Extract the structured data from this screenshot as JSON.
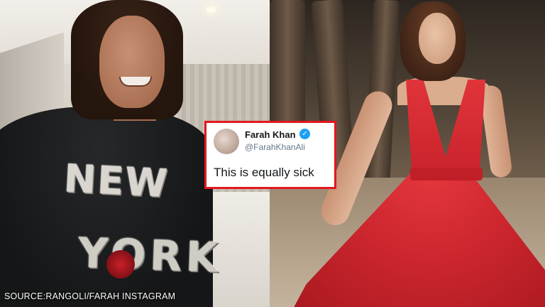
{
  "tweet": {
    "name": "Farah Khan",
    "handle": "@FarahKhanAli",
    "text": "This is equally sick",
    "verified_icon": "verified-check-icon",
    "border_color": "#e0181e"
  },
  "left_photo": {
    "sweater_line_1": "NEW",
    "sweater_line_2": "YORK"
  },
  "caption": {
    "text": "SOURCE:RANGOLI/FARAH INSTAGRAM"
  }
}
